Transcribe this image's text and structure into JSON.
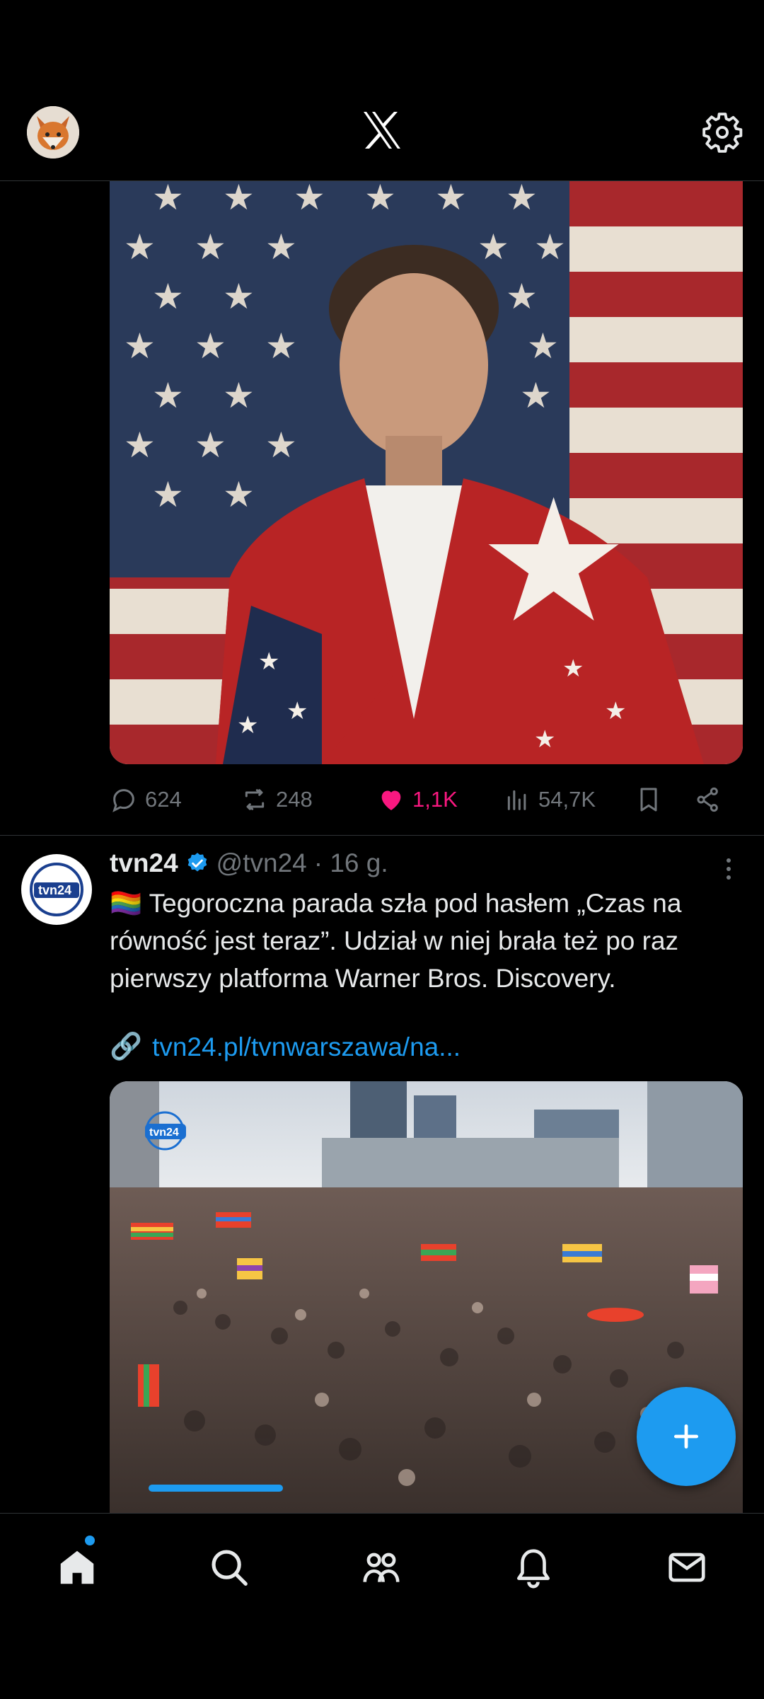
{
  "header": {
    "logo": "x-logo",
    "settings_icon": "gear-icon",
    "avatar": "fox-avatar"
  },
  "tweet1": {
    "media": "portrait-with-american-flag-image",
    "replies": "624",
    "retweets": "248",
    "likes": "1,1K",
    "views": "54,7K",
    "colors": {
      "liked": "#f91880",
      "muted": "#71767b"
    }
  },
  "tweet2": {
    "display_name": "tvn24",
    "handle": "@tvn24",
    "time": "· 16 g.",
    "text": "🏳️‍🌈 Tegoroczna parada szła pod hasłem „Czas na równość jest teraz”. Udział w niej brała też po raz pierwszy platforma Warner Bros. Discovery.",
    "link_emoji": "🔗",
    "link": "tvn24.pl/tvnwarszawa/na...",
    "media_watermark": "tvn24",
    "media": "pride-parade-crowd-image",
    "video_progress": 0.2
  },
  "bottom_nav": [
    "home-icon",
    "search-icon",
    "communities-icon",
    "notifications-icon",
    "messages-icon"
  ],
  "colors": {
    "accent": "#1d9bf0",
    "background": "#000000",
    "text": "#e7e9ea"
  }
}
